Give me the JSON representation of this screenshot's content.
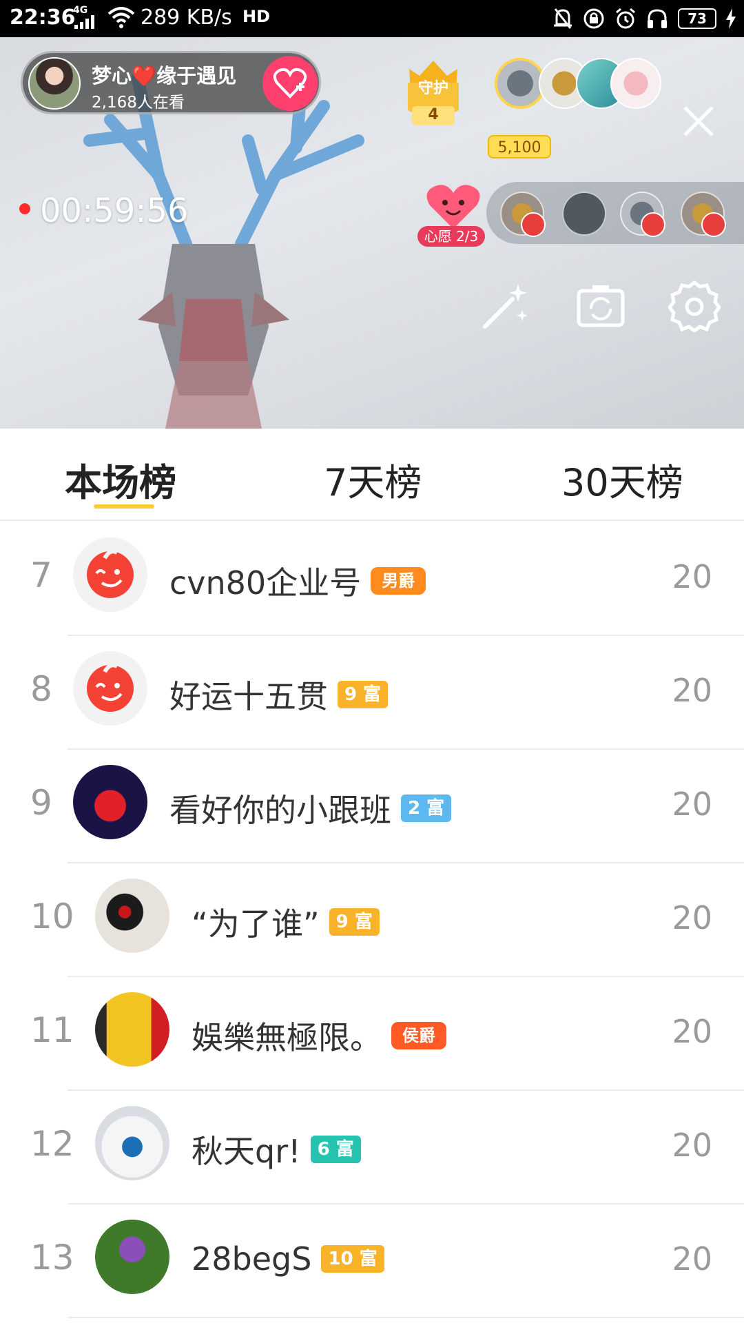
{
  "status_bar": {
    "time": "22:36",
    "network": "4G",
    "speed": "289 KB/s",
    "hd": "HD",
    "battery": "73"
  },
  "live": {
    "host_name": "梦心❤️缘于遇见",
    "viewers": "2,168人在看",
    "guard_label": "守护",
    "guard_count": "4",
    "top_contrib": "5,100",
    "timer": "00:59:56",
    "wish_label": "心愿 2/3"
  },
  "tabs": [
    {
      "label": "本场榜",
      "active": true
    },
    {
      "label": "7天榜",
      "active": false
    },
    {
      "label": "30天榜",
      "active": false
    }
  ],
  "rows": [
    {
      "rank": "7",
      "name": "cvn80企业号",
      "badge": "男爵",
      "badge_type": "title",
      "badge_color": "#ff8a1e",
      "score": "20",
      "avatar": "default"
    },
    {
      "rank": "8",
      "name": "好运十五贯",
      "badge": "9 富",
      "badge_type": "rich",
      "badge_color": "#f8b32a",
      "score": "20",
      "avatar": "default"
    },
    {
      "rank": "9",
      "name": "看好你的小跟班",
      "badge": "2 富",
      "badge_type": "rich",
      "badge_color": "#5cb8ee",
      "score": "20",
      "avatar": "heart"
    },
    {
      "rank": "10",
      "name": "“为了谁”",
      "badge": "9 富",
      "badge_type": "rich",
      "badge_color": "#f8b32a",
      "score": "20",
      "avatar": "earring"
    },
    {
      "rank": "11",
      "name": "娛樂無極限。",
      "badge": "侯爵",
      "badge_type": "title",
      "badge_color": "#ff5a26",
      "score": "20",
      "avatar": "yellow"
    },
    {
      "rank": "12",
      "name": "秋天qr!",
      "badge": "6 富",
      "badge_type": "rich",
      "badge_color": "#26c4b0",
      "score": "20",
      "avatar": "boat"
    },
    {
      "rank": "13",
      "name": "28begS",
      "badge": "10 富",
      "badge_type": "rich",
      "badge_color": "#f8b32a",
      "score": "20",
      "avatar": "flower"
    }
  ]
}
